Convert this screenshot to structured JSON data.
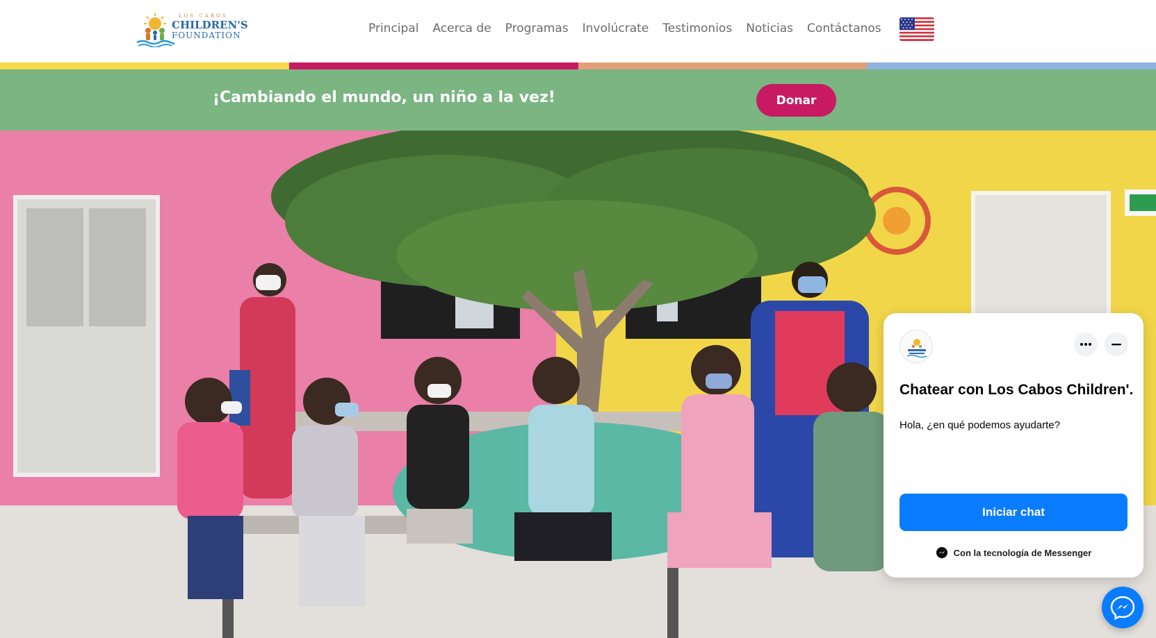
{
  "logo": {
    "line1": "LOS CABOS",
    "line2": "CHILDREN'S",
    "line3": "FOUNDATION"
  },
  "nav": {
    "items": [
      {
        "label": "Principal"
      },
      {
        "label": "Acerca de"
      },
      {
        "label": "Programas"
      },
      {
        "label": "Involúcrate"
      },
      {
        "label": "Testimonios"
      },
      {
        "label": "Noticias"
      },
      {
        "label": "Contáctanos"
      }
    ],
    "language_icon": "us-flag-icon"
  },
  "stripe_colors": [
    "#f5d84c",
    "#c81a63",
    "#e0a07a",
    "#8fb3de"
  ],
  "banner": {
    "tagline": "¡Cambiando el mundo, un niño a la vez!",
    "donate_label": "Donar",
    "background": "#7bb582",
    "donate_color": "#c81a63"
  },
  "messenger": {
    "title": "Chatear con Los Cabos Children'...",
    "greeting": "Hola, ¿en qué podemos ayudarte?",
    "start_label": "Iniciar chat",
    "powered_by": "Con la tecnología de Messenger",
    "accent": "#0a7cff",
    "icons": [
      "more-options-icon",
      "minimize-icon",
      "messenger-icon"
    ]
  }
}
